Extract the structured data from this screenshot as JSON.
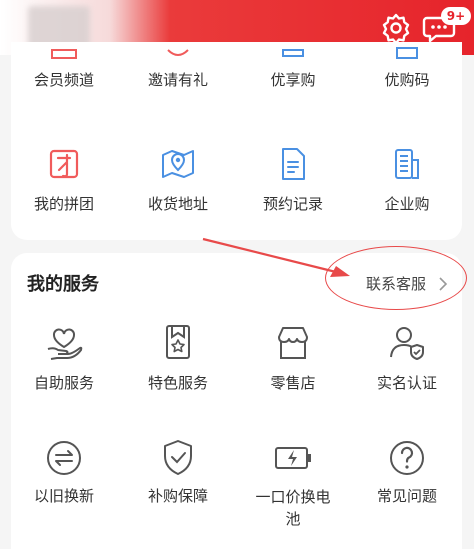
{
  "header": {
    "badge": "9+",
    "colors": {
      "brand_red": "#e6242b",
      "icon_red": "#f05b5b",
      "icon_blue": "#4a90e2",
      "icon_gray": "#555555"
    }
  },
  "top_grid": {
    "row1": [
      {
        "label": "会员频道",
        "icon": "member-icon"
      },
      {
        "label": "邀请有礼",
        "icon": "invite-gift-icon"
      },
      {
        "label": "优享购",
        "icon": "premium-buy-icon"
      },
      {
        "label": "优购码",
        "icon": "coupon-code-icon"
      }
    ],
    "row2": [
      {
        "label": "我的拼团",
        "icon": "group-buy-icon"
      },
      {
        "label": "收货地址",
        "icon": "address-map-icon"
      },
      {
        "label": "预约记录",
        "icon": "reservation-doc-icon"
      },
      {
        "label": "企业购",
        "icon": "enterprise-buy-icon"
      }
    ]
  },
  "services": {
    "title": "我的服务",
    "contact_link": "联系客服",
    "row1": [
      {
        "label": "自助服务",
        "icon": "heart-hand-icon"
      },
      {
        "label": "特色服务",
        "icon": "star-bookmark-icon"
      },
      {
        "label": "零售店",
        "icon": "store-icon"
      },
      {
        "label": "实名认证",
        "icon": "user-verified-icon"
      }
    ],
    "row2": [
      {
        "label": "以旧换新",
        "icon": "trade-in-icon"
      },
      {
        "label": "补购保障",
        "icon": "shield-check-icon"
      },
      {
        "label": "一口价换电池",
        "icon": "battery-icon"
      },
      {
        "label": "常见问题",
        "icon": "question-icon"
      }
    ]
  }
}
